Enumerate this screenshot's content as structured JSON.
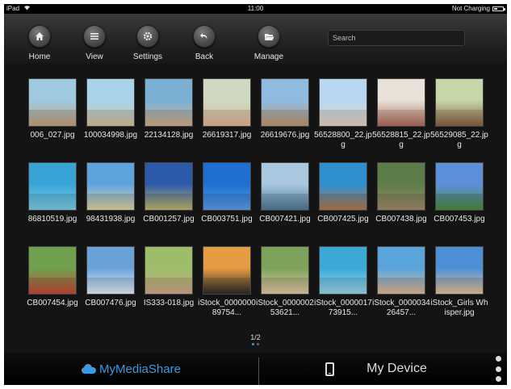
{
  "status_bar": {
    "device": "iPad",
    "time": "11:00",
    "charging": "Not Charging"
  },
  "toolbar": {
    "buttons": [
      {
        "label": "Home",
        "icon": "home-icon"
      },
      {
        "label": "View",
        "icon": "list-icon"
      },
      {
        "label": "Settings",
        "icon": "gear-icon"
      },
      {
        "label": "Back",
        "icon": "back-arrow-icon"
      },
      {
        "label": "Manage",
        "icon": "folder-open-icon"
      }
    ],
    "search_placeholder": "Search"
  },
  "grid": {
    "tiles": [
      {
        "label": "006_027.jpg",
        "colors": [
          "#9ec9e0",
          "#c9a27a"
        ]
      },
      {
        "label": "100034998.jpg",
        "colors": [
          "#a9d3ea",
          "#d8c49a"
        ]
      },
      {
        "label": "22134128.jpg",
        "colors": [
          "#7ab0d4",
          "#d9b08a"
        ]
      },
      {
        "label": "26619317.jpg",
        "colors": [
          "#cfd9c2",
          "#e5b694"
        ]
      },
      {
        "label": "26619676.jpg",
        "colors": [
          "#8fbbe0",
          "#c4986e"
        ]
      },
      {
        "label": "56528800_22.jpg",
        "colors": [
          "#b7d7f2",
          "#e9d5c0"
        ]
      },
      {
        "label": "56528815_22.jpg",
        "colors": [
          "#e8e2d8",
          "#b46a5a"
        ]
      },
      {
        "label": "56529085_22.jpg",
        "colors": [
          "#c6d6a8",
          "#8a6042"
        ]
      },
      {
        "label": "86810519.jpg",
        "colors": [
          "#3aa3d6",
          "#7fd1e8"
        ]
      },
      {
        "label": "98431938.jpg",
        "colors": [
          "#5fa3dd",
          "#e6d6a2"
        ]
      },
      {
        "label": "CB001257.jpg",
        "colors": [
          "#2c5aa8",
          "#c3b96b"
        ]
      },
      {
        "label": "CB003751.jpg",
        "colors": [
          "#1e6fd0",
          "#5b9ee8"
        ]
      },
      {
        "label": "CB007421.jpg",
        "colors": [
          "#a9c8e0",
          "#4e7a98"
        ]
      },
      {
        "label": "CB007425.jpg",
        "colors": [
          "#2f8fcf",
          "#b77a4c"
        ]
      },
      {
        "label": "CB007438.jpg",
        "colors": [
          "#5c7d4a",
          "#a58b6a"
        ]
      },
      {
        "label": "CB007453.jpg",
        "colors": [
          "#5c90d8",
          "#4f8a3a"
        ]
      },
      {
        "label": "CB007454.jpg",
        "colors": [
          "#6fa04e",
          "#c94a3a"
        ]
      },
      {
        "label": "CB007476.jpg",
        "colors": [
          "#6aa2d8",
          "#e4eef6"
        ]
      },
      {
        "label": "IS333-018.jpg",
        "colors": [
          "#9dbd6a",
          "#d4a88a"
        ]
      },
      {
        "label": "iStock_000000089754...",
        "colors": [
          "#e59c44",
          "#2a2a2a"
        ]
      },
      {
        "label": "iStock_000000253621...",
        "colors": [
          "#7da25a",
          "#e8c9a8"
        ]
      },
      {
        "label": "iStock_000001773915...",
        "colors": [
          "#3ca8d8",
          "#9fd8ee"
        ]
      },
      {
        "label": "iStock_000003426457...",
        "colors": [
          "#5aa4dc",
          "#e2b896"
        ]
      },
      {
        "label": "iStock_Girls Whisper.jpg",
        "colors": [
          "#4d8fd4",
          "#e7c49a"
        ]
      }
    ]
  },
  "pagination": {
    "label": "1/2",
    "current": 1,
    "total": 2
  },
  "bottom_bar": {
    "left_tab": "MyMediaShare",
    "right_tab": "My Device"
  },
  "colors": {
    "accent": "#3d9ae0",
    "background": "#141414",
    "text": "#e8e8e8"
  }
}
